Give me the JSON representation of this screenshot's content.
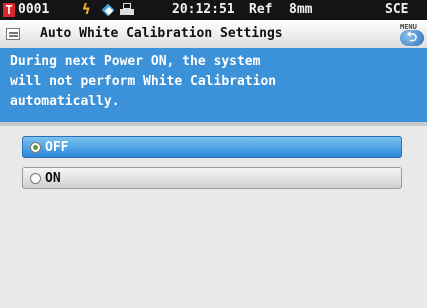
{
  "status_bar": {
    "target_icon": "T",
    "target_number": "0001",
    "icons": [
      "battery-bolt-icon",
      "white-calibration-icon",
      "printer-icon"
    ],
    "time": "20:12:51",
    "reference": "Ref",
    "aperture": "8mm",
    "mode": "SCE"
  },
  "header": {
    "title": "Auto White Calibration Settings",
    "menu_label": "MENU",
    "back_glyph": "⮌"
  },
  "message": {
    "lines": [
      "During next Power ON, the system",
      "will not perform White Calibration",
      "automatically."
    ]
  },
  "options": [
    {
      "label": "OFF",
      "selected": true
    },
    {
      "label": "ON",
      "selected": false
    }
  ],
  "colors": {
    "accent_blue": "#3b92d8",
    "status_red": "#d8262a",
    "bolt_yellow": "#f3b522"
  }
}
